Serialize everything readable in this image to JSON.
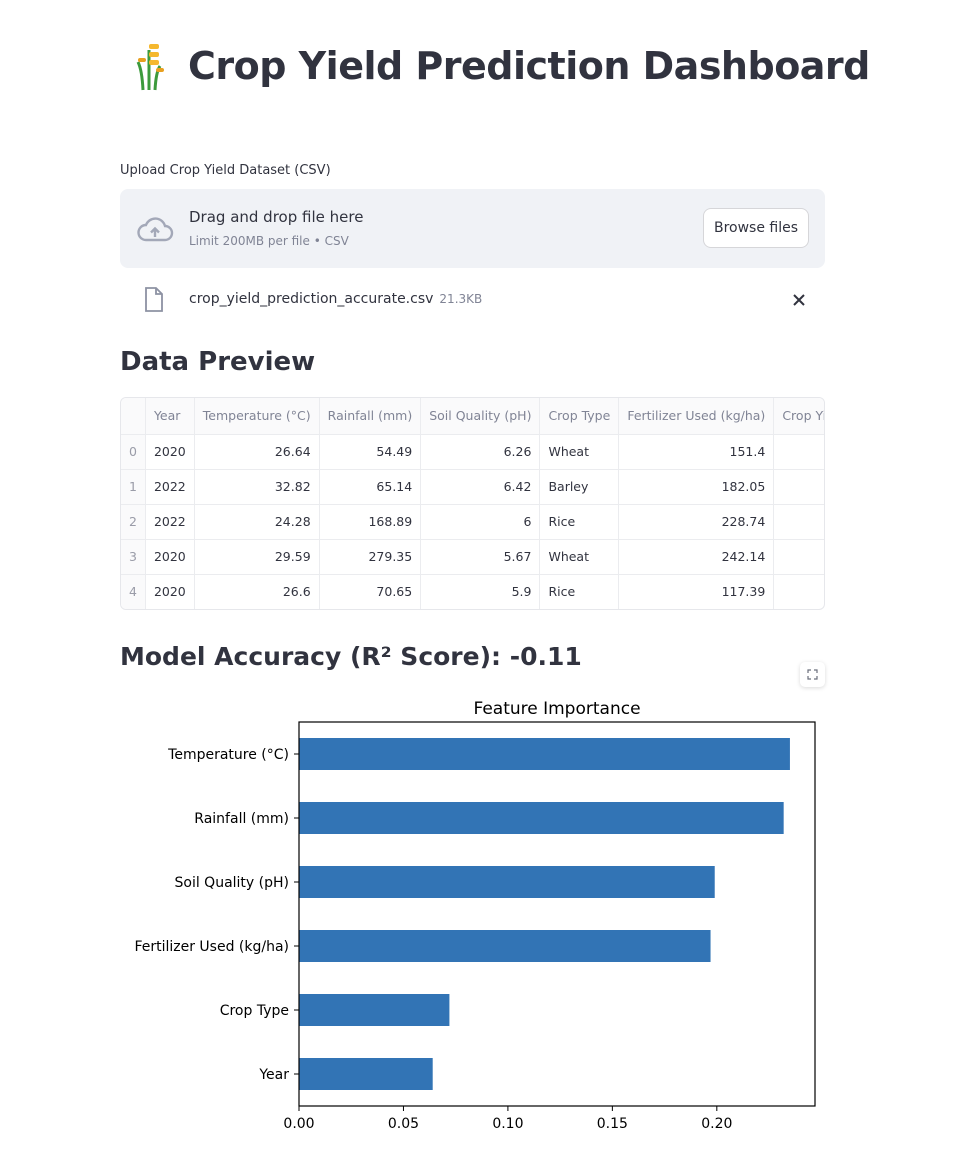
{
  "header": {
    "title": "Crop Yield Prediction Dashboard",
    "icon": "sheaf-of-rice-icon"
  },
  "uploader": {
    "label": "Upload Crop Yield Dataset (CSV)",
    "drop_text": "Drag and drop file here",
    "limit_text": "Limit 200MB per file • CSV",
    "browse_label": "Browse files",
    "file": {
      "name": "crop_yield_prediction_accurate.csv",
      "size": "21.3KB"
    }
  },
  "preview": {
    "heading": "Data Preview",
    "columns": [
      "",
      "Year",
      "Temperature (°C)",
      "Rainfall (mm)",
      "Soil Quality (pH)",
      "Crop Type",
      "Fertilizer Used (kg/ha)",
      "Crop Yie"
    ],
    "rows": [
      [
        "0",
        "2020",
        "26.64",
        "54.49",
        "6.26",
        "Wheat",
        "151.4",
        ""
      ],
      [
        "1",
        "2022",
        "32.82",
        "65.14",
        "6.42",
        "Barley",
        "182.05",
        ""
      ],
      [
        "2",
        "2022",
        "24.28",
        "168.89",
        "6",
        "Rice",
        "228.74",
        ""
      ],
      [
        "3",
        "2020",
        "29.59",
        "279.35",
        "5.67",
        "Wheat",
        "242.14",
        ""
      ],
      [
        "4",
        "2020",
        "26.6",
        "70.65",
        "5.9",
        "Rice",
        "117.39",
        ""
      ]
    ]
  },
  "accuracy": {
    "heading": "Model Accuracy (R² Score): -0.11"
  },
  "chart_data": {
    "type": "bar",
    "orientation": "horizontal",
    "title": "Feature Importance",
    "xlabel": "",
    "ylabel": "",
    "categories": [
      "Temperature (°C)",
      "Rainfall (mm)",
      "Soil Quality (pH)",
      "Fertilizer Used (kg/ha)",
      "Crop Type",
      "Year"
    ],
    "values": [
      0.235,
      0.232,
      0.199,
      0.197,
      0.072,
      0.064
    ],
    "xlim": [
      0,
      0.247
    ],
    "xticks": [
      "0.00",
      "0.05",
      "0.10",
      "0.15",
      "0.20"
    ],
    "bar_color": "#3274b5",
    "grid": false
  }
}
